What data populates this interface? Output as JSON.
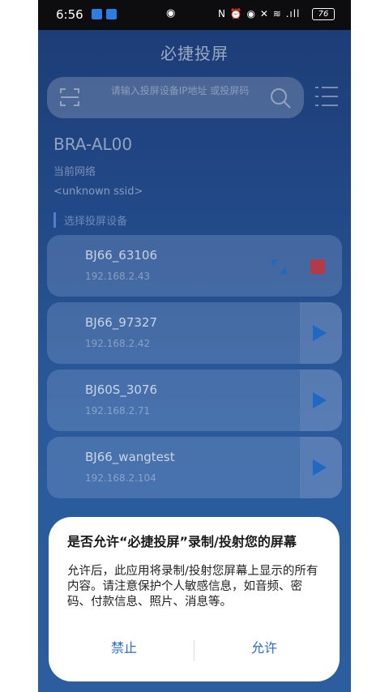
{
  "status_bar": {
    "time": "6:56",
    "icons_text": "N ⏰ ◉ ✕ ≋ .ıll",
    "battery": "76"
  },
  "app": {
    "title": "必捷投屏"
  },
  "search": {
    "placeholder": "请输入投屏设备IP地址 或投屏码"
  },
  "device": {
    "name": "BRA-AL00",
    "network_label": "当前网络",
    "ssid": "<unknown ssid>"
  },
  "section_title": "选择投屏设备",
  "devices": [
    {
      "name": "BJ66_63106",
      "ip": "192.168.2.43"
    },
    {
      "name": "BJ66_97327",
      "ip": "192.168.2.42"
    },
    {
      "name": "BJ60S_3076",
      "ip": "192.168.2.71"
    },
    {
      "name": "BJ66_wangtest",
      "ip": "192.168.2.104"
    }
  ],
  "dialog": {
    "title": "是否允许“必捷投屏”录制/投射您的屏幕",
    "body": "允许后，此应用将录制/投射您屏幕上显示的所有内容。请注意保护个人敏感信息，如音频、密码、付款信息、照片、消息等。",
    "deny": "禁止",
    "allow": "允许"
  },
  "colors": {
    "accent": "#2f6bd3",
    "stop": "#b43a4a",
    "play": "#1f68c4"
  }
}
